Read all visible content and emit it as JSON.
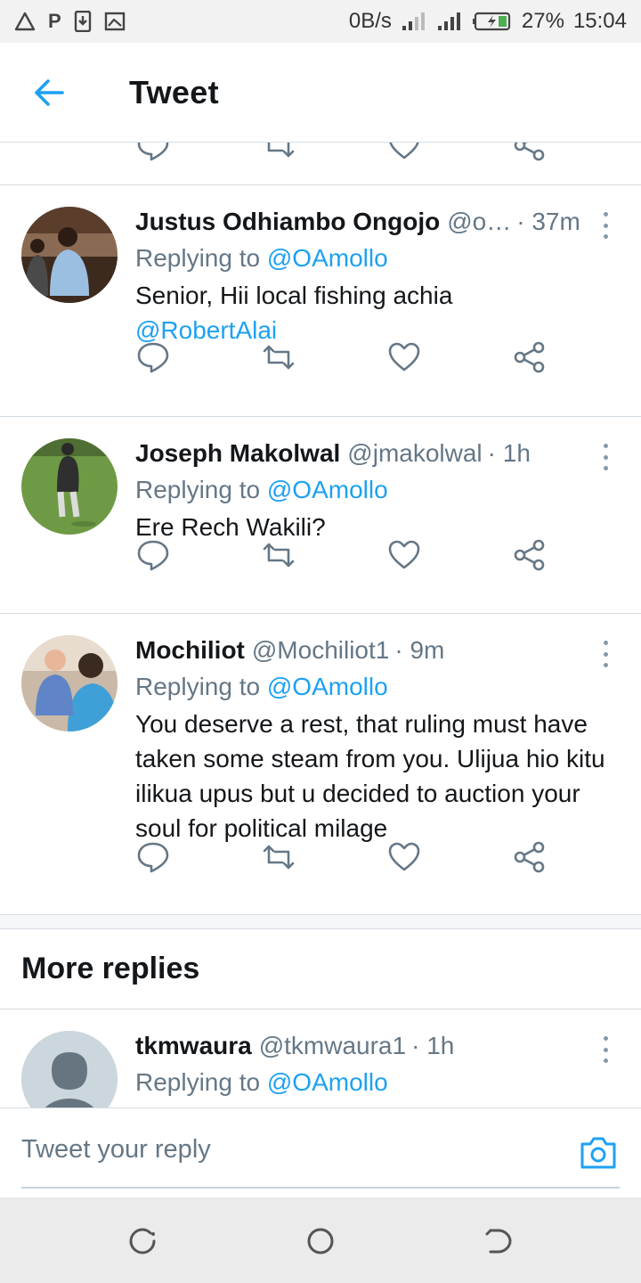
{
  "status_bar": {
    "left_icons": [
      "warning-triangle-icon",
      "p-icon",
      "download-icon",
      "image-icon"
    ],
    "network_speed": "0B/s",
    "battery": "27%",
    "time": "15:04"
  },
  "header": {
    "title": "Tweet",
    "back_icon": "arrow-left-icon"
  },
  "tweets": [
    {
      "name": "Justus Odhiambo Ongojo",
      "handle": "@o…",
      "time": "· 37m",
      "replying_prefix": "Replying to",
      "replying_to": "@OAmollo",
      "text": "Senior, Hii local fishing achia",
      "mention": "@RobertAlai"
    },
    {
      "name": "Joseph Makolwal",
      "handle": "@jmakolwal",
      "time": "· 1h",
      "replying_prefix": "Replying to",
      "replying_to": "@OAmollo",
      "text": "Ere Rech Wakili?"
    },
    {
      "name": "Mochiliot",
      "handle": "@Mochiliot1",
      "time": "· 9m",
      "replying_prefix": "Replying to",
      "replying_to": "@OAmollo",
      "text": "You deserve a rest, that ruling must have taken some steam from you. Ulijua hio kitu ilikua upus but u decided to auction your soul for political milage"
    }
  ],
  "more_replies": {
    "heading": "More replies",
    "tweet": {
      "name": "tkmwaura",
      "handle": "@tkmwaura1",
      "time": "· 1h",
      "replying_prefix": "Replying to",
      "replying_to": "@OAmollo"
    }
  },
  "composer": {
    "placeholder": "Tweet your reply",
    "camera_icon": "camera-icon"
  },
  "colors": {
    "accent": "#1da1f2",
    "secondary_text": "#657786",
    "divider": "#d6dde3"
  }
}
